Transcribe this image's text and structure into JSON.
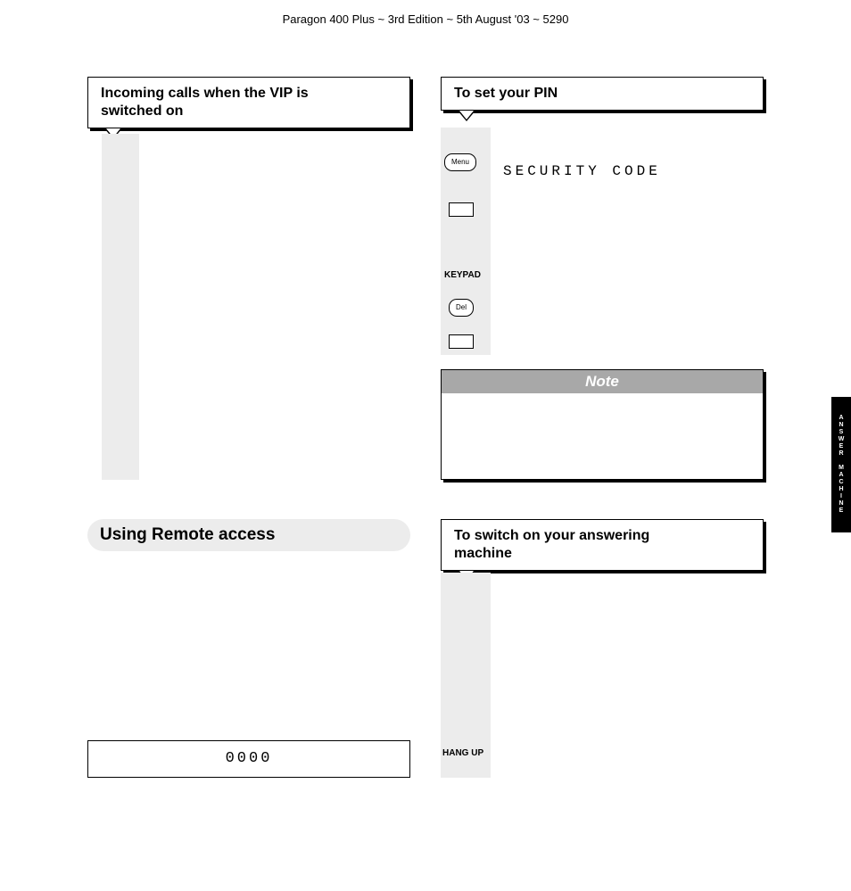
{
  "header": "Paragon 400 Plus ~ 3rd Edition ~ 5th August '03 ~ 5290",
  "left": {
    "box1_line1": "Incoming calls when the VIP is",
    "box1_line2": "switched on",
    "section_title": "Using Remote access",
    "display_value": "0000"
  },
  "right": {
    "box1_title": "To set your PIN",
    "menu_btn": "Menu",
    "security_code": "SECURITY CODE",
    "keypad_label": "KEYPAD",
    "del_btn": "Del",
    "note_heading": "Note",
    "box2_line1": "To switch on your answering",
    "box2_line2": "machine",
    "hang_up": "HANG UP"
  },
  "side_tab": "ANSWER MACHINE"
}
